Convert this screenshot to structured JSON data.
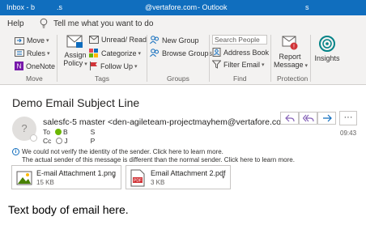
{
  "titlebar": {
    "inbox": "Inbox - b",
    "sep": ".s",
    "account": "@vertafore.com",
    "app": "- Outlook",
    "s2": "s"
  },
  "tellbar": {
    "help": "Help",
    "tell_me": "Tell me what you want to do"
  },
  "ribbon": {
    "move": {
      "move": "Move",
      "rules": "Rules",
      "onenote": "OneNote",
      "label": "Move"
    },
    "tags": {
      "assign_policy_1": "Assign",
      "assign_policy_2": "Policy",
      "unread_read": "Unread/ Read",
      "categorize": "Categorize",
      "follow_up": "Follow Up",
      "label": "Tags"
    },
    "groups": {
      "new_group": "New Group",
      "browse_groups": "Browse Groups",
      "label": "Groups"
    },
    "find": {
      "search_people": "Search People",
      "address_book": "Address Book",
      "filter_email": "Filter Email",
      "label": "Find"
    },
    "protection": {
      "report_1": "Report",
      "report_2": "Message",
      "label": "Protection"
    },
    "insights": {
      "label": "Insights"
    }
  },
  "message": {
    "subject": "Demo Email Subject Line",
    "avatar": "?",
    "sender": "salesfc-5 master <den-agileteam-projectmayhem@vertafore.com>",
    "to_label": "To",
    "to_1": "B",
    "to_2": "S",
    "cc_label": "Cc",
    "cc_1": "J",
    "cc_2": "P",
    "time": "09:43",
    "more": "···",
    "warning_1": "We could not verify the identity of the sender. Click here to learn more.",
    "warning_2": "The actual sender of this message is different than the normal sender. Click here to learn more."
  },
  "attachments": [
    {
      "name": "E-mail Attachment 1.png",
      "size": "15 KB"
    },
    {
      "name": "Email Attachment 2.pdf",
      "size": "3 KB"
    }
  ],
  "body": {
    "text": "Text body of email here."
  },
  "colors": {
    "titlebar": "#106ebe",
    "accent": "#0f6cbd",
    "presence_available": "#6bb700"
  }
}
